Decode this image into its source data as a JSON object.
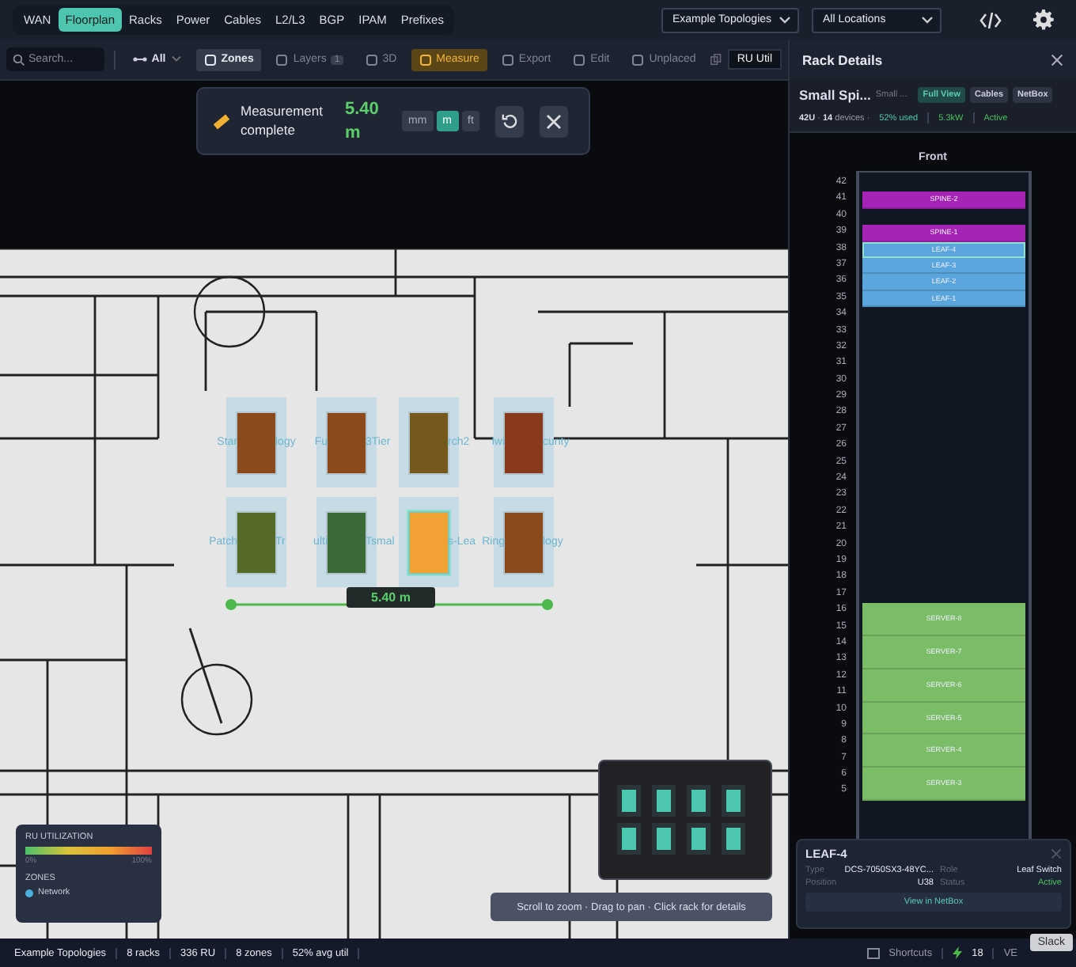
{
  "nav": {
    "tabs": [
      {
        "label": "WAN",
        "selected": false
      },
      {
        "label": "Floorplan",
        "selected": true
      },
      {
        "label": "Racks",
        "selected": false
      },
      {
        "label": "Power",
        "selected": false
      },
      {
        "label": "Cables",
        "selected": false
      },
      {
        "label": "L2/L3",
        "selected": false
      },
      {
        "label": "BGP",
        "selected": false
      },
      {
        "label": "IPAM",
        "selected": false
      },
      {
        "label": "Prefixes",
        "selected": false
      }
    ],
    "selects": [
      "Example Topologies",
      "All Locations"
    ]
  },
  "toolbar": {
    "search": {
      "placeholder": "Search..."
    },
    "filter": "All",
    "tools": [
      {
        "label": "Zones",
        "kind": "toggle",
        "active": true
      },
      {
        "label": "Layers",
        "kind": "toggle",
        "active": false,
        "badge": "1"
      },
      {
        "label": "3D",
        "kind": "toggle",
        "active": false
      },
      {
        "label": "Measure",
        "kind": "mode",
        "active": true
      },
      {
        "label": "Export",
        "kind": "action"
      },
      {
        "label": "Edit",
        "kind": "mode",
        "active": false
      },
      {
        "label": "Unplaced",
        "kind": "toggle",
        "active": false
      }
    ],
    "metric": "RU Util"
  },
  "measure": {
    "title": "Measurement complete",
    "value": "5.40 m",
    "units": [
      {
        "label": "mm",
        "selected": false
      },
      {
        "label": "m",
        "selected": true
      },
      {
        "label": "ft",
        "selected": false
      }
    ]
  },
  "floorplan": {
    "zones": [
      {
        "label_left": "Star",
        "label_right": "logy",
        "color": "#8a4a1c",
        "selected": false
      },
      {
        "label_left": "Fu",
        "label_right": "3Tier",
        "color": "#8a4a1c",
        "selected": false
      },
      {
        "label_right": "rch2",
        "color": "#74581c",
        "selected": false
      },
      {
        "label_left": "lwi",
        "label_right": "curity",
        "color": "#8a3a1c",
        "selected": false
      },
      {
        "label_left": "Patch",
        "label_right": "Tr",
        "color": "#566a28",
        "selected": false
      },
      {
        "label_left": "ulti",
        "label_right": "Tsmal",
        "color": "#3c6a36",
        "selected": false
      },
      {
        "label_right": "s-Lea",
        "color": "#f0a232",
        "selected": true
      },
      {
        "label_left": "Ring",
        "label_right": "logy",
        "color": "#8a4a1c",
        "selected": false
      }
    ],
    "measure_label": "5.40 m"
  },
  "legend": {
    "title": "RU UTILIZATION",
    "min": "0%",
    "max": "100%",
    "zones_title": "ZONES",
    "zones": [
      {
        "label": "Network",
        "color": "#4ab0e0"
      }
    ]
  },
  "hint": "Scroll to zoom · Drag to pan · Click rack for details",
  "panel": {
    "title": "Rack Details",
    "rack_name": "Small Spi...",
    "rack_sub": "Small ...",
    "buttons": [
      {
        "label": "Full View",
        "selected": true
      },
      {
        "label": "Cables",
        "selected": false
      },
      {
        "label": "NetBox",
        "selected": false
      }
    ],
    "summary": "**42U** · **14** devices ·",
    "used": "52% used",
    "power": "5.3kW",
    "status": "Active",
    "face": "Front",
    "units": [
      "42",
      "41",
      "40",
      "39",
      "38",
      "37",
      "36",
      "35",
      "34",
      "33",
      "32",
      "31",
      "30",
      "29",
      "28",
      "27",
      "26",
      "25",
      "24",
      "23",
      "22",
      "21",
      "20",
      "19",
      "18",
      "17",
      "16",
      "15",
      "14",
      "13",
      "12",
      "11",
      "10",
      "9",
      "8",
      "7",
      "6",
      "5"
    ],
    "slots": [
      {
        "kind": "empty"
      },
      {
        "kind": "device",
        "label": "SPINE-2",
        "color": "#a523b5",
        "selected": false
      },
      {
        "kind": "empty"
      },
      {
        "kind": "device",
        "label": "SPINE-1",
        "color": "#a523b5",
        "selected": false
      },
      {
        "kind": "device",
        "label": "LEAF-4",
        "color": "#5aa6dc",
        "selected": true
      },
      {
        "kind": "device",
        "label": "LEAF-3",
        "color": "#5aa6dc",
        "selected": false
      },
      {
        "kind": "device",
        "label": "LEAF-2",
        "color": "#5aa6dc",
        "selected": false
      },
      {
        "kind": "device",
        "label": "LEAF-1",
        "color": "#5aa6dc",
        "selected": false
      },
      {
        "kind": "empty"
      },
      {
        "kind": "empty"
      },
      {
        "kind": "empty"
      },
      {
        "kind": "empty"
      },
      {
        "kind": "empty"
      },
      {
        "kind": "empty"
      },
      {
        "kind": "empty"
      },
      {
        "kind": "empty"
      },
      {
        "kind": "empty"
      },
      {
        "kind": "empty"
      },
      {
        "kind": "empty"
      },
      {
        "kind": "empty"
      },
      {
        "kind": "empty"
      },
      {
        "kind": "empty"
      },
      {
        "kind": "empty"
      },
      {
        "kind": "empty"
      },
      {
        "kind": "empty"
      },
      {
        "kind": "empty"
      },
      {
        "kind": "device-2u",
        "label": "SERVER-8",
        "color": "#7abd66",
        "selected": false
      },
      {
        "kind": "device-2u",
        "label": "SERVER-7",
        "color": "#7abd66",
        "selected": false
      },
      {
        "kind": "device-2u",
        "label": "SERVER-6",
        "color": "#7abd66",
        "selected": false
      },
      {
        "kind": "device-2u",
        "label": "SERVER-5",
        "color": "#7abd66",
        "selected": false
      },
      {
        "kind": "device-2u",
        "label": "SERVER-4",
        "color": "#7abd66",
        "selected": false
      },
      {
        "kind": "device-2u",
        "label": "SERVER-3",
        "color": "#7abd66",
        "selected": false
      }
    ],
    "popup": {
      "title": "LEAF-4",
      "fields": [
        {
          "label": "Type",
          "value": "DCS-7050SX3-48YC...",
          "kind": "plain"
        },
        {
          "label": "Role",
          "value": "Leaf Switch",
          "kind": "plain"
        },
        {
          "label": "Position",
          "value": "U38",
          "kind": "plain"
        },
        {
          "label": "Status",
          "value": "Active",
          "kind": "status"
        }
      ],
      "action": "View in NetBox"
    }
  },
  "status_bar": {
    "items": [
      "Example Topologies",
      "8 racks",
      "336 RU",
      "8 zones",
      "52% avg util"
    ],
    "shortcuts": "Shortcuts",
    "count": "18",
    "cut": "VE",
    "tooltip": "Slack"
  }
}
